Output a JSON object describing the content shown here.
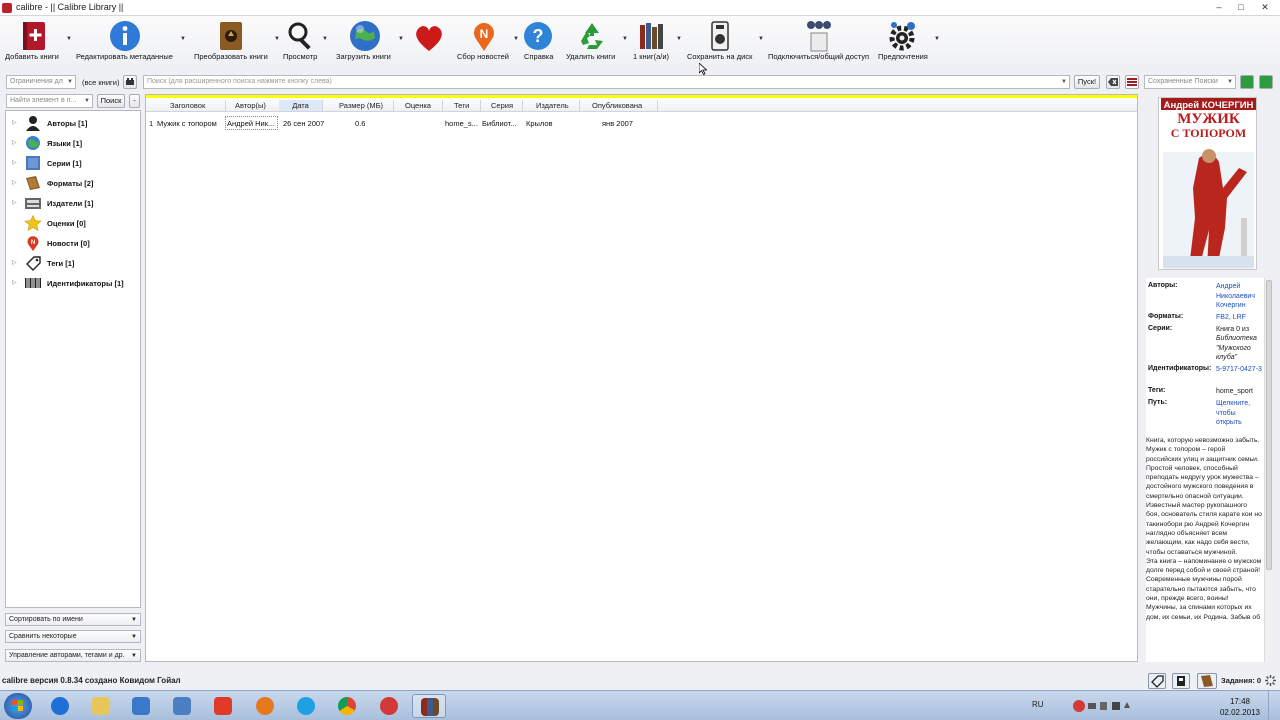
{
  "window": {
    "title": "calibre - || Calibre Library ||",
    "minimize_label": "–",
    "maximize_label": "□",
    "close_label": "✕"
  },
  "toolbar": {
    "items": [
      {
        "label": "Добавить книги",
        "icon": "add-book-icon"
      },
      {
        "label": "Редактировать метаданные",
        "icon": "info-icon"
      },
      {
        "label": "Преобразовать книги",
        "icon": "convert-icon"
      },
      {
        "label": "Просмотр",
        "icon": "magnifier-icon"
      },
      {
        "label": "Загрузить книги",
        "icon": "globe-icon"
      },
      {
        "label": "",
        "icon": "heart-icon"
      },
      {
        "label": "Сбор новостей",
        "icon": "news-icon"
      },
      {
        "label": "Справка",
        "icon": "help-icon"
      },
      {
        "label": "Удалить книги",
        "icon": "recycle-icon"
      },
      {
        "label": "1 книг(а/и)",
        "icon": "library-icon"
      },
      {
        "label": "Сохранить на диск",
        "icon": "save-icon"
      },
      {
        "label": "Подключиться/общий доступ",
        "icon": "connect-icon"
      },
      {
        "label": "Предпочтения",
        "icon": "gear-icon"
      }
    ]
  },
  "search": {
    "restrict_label": "Ограничения дл",
    "all_books": "(все книги)",
    "placeholder": "Поиск (для расширенного поиска нажмите кнопку слева)",
    "go_label": "Пуск!",
    "saved_searches": "Сохраненные Поиски"
  },
  "tagbrowser": {
    "find_placeholder": "Найти элемент в п...",
    "find_button": "Поиск",
    "collapse_button": "-",
    "categories": [
      {
        "label": "Авторы",
        "count": "[1]",
        "icon": "user-icon"
      },
      {
        "label": "Языки",
        "count": "[1]",
        "icon": "languages-icon"
      },
      {
        "label": "Серии",
        "count": "[1]",
        "icon": "series-icon"
      },
      {
        "label": "Форматы",
        "count": "[2]",
        "icon": "book-icon"
      },
      {
        "label": "Издатели",
        "count": "[1]",
        "icon": "publisher-icon"
      },
      {
        "label": "Оценки",
        "count": "[0]",
        "icon": "star-icon"
      },
      {
        "label": "Новости",
        "count": "[0]",
        "icon": "news-icon"
      },
      {
        "label": "Теги",
        "count": "[1]",
        "icon": "tag-icon"
      },
      {
        "label": "Идентификаторы",
        "count": "[1]",
        "icon": "barcode-icon"
      }
    ],
    "sort_by": "Сортировать по имени",
    "match": "Сравнить некоторые",
    "manage": "Управление авторами, тегами и др."
  },
  "booklist": {
    "columns": [
      "Заголовок",
      "Автор(ы)",
      "Дата",
      "Размер (МБ)",
      "Оценка",
      "Теги",
      "Серия",
      "Издатель",
      "Опубликована"
    ],
    "rows": [
      {
        "num": "1",
        "title": "Мужик с топором",
        "author": "Андрей Ник...",
        "date": "26 сен 2007",
        "size": "0.6",
        "rating": "",
        "tags": "home_s...",
        "series": "Библиот...",
        "publisher": "Крылов",
        "published": "янв 2007"
      }
    ]
  },
  "cover": {
    "author": "Андрей КОЧЕРГИН",
    "title_line1": "МУЖИК",
    "title_line2": "С ТОПОРОМ"
  },
  "details": {
    "authors_key": "Авторы:",
    "authors_val": "Андрей Николаевич Кочергин",
    "formats_key": "Форматы:",
    "formats_val": "FB2, LRF",
    "series_key": "Серии:",
    "series_val_1": "Книга 0 из",
    "series_val_2": "Библиотека \"Мужского клуба\"",
    "ids_key": "Идентификаторы:",
    "ids_val": "5-9717-0427-3",
    "tags_key": "Теги:",
    "tags_val": "home_sport",
    "path_key": "Путь:",
    "path_val": "Щелкните, чтобы открыть",
    "comments": "Книга, которую невозможно забыть. Мужик с топором – герой российских улиц и защитник семьи. Простой человек, способный преподать недругу урок мужества – достойного мужского поведения в смертельно опасной ситуации. Известный мастер рукопашного боя, основатель стиля карате кои но такинобори рю Андрей Кочергин наглядно объясняет всем желающим, как надо себя вести, чтобы оставаться мужчиной.\nЭта книга – напоминание о мужском долге перед собой и своей страной! Современные мужчины порой старательно пытаются забыть, что они, прежде всего, воины! Мужчины, за спинами которых их дом, их семьи, их Родина. Забыв об"
  },
  "statusbar": {
    "version": "calibre версия 0.8.34 создано Ковидом Гойал",
    "jobs": "Задания: 0"
  },
  "taskbar": {
    "lang": "RU",
    "time": "17:48",
    "date": "02.02.2013"
  },
  "colors": {
    "accent": "#1a4fbf",
    "highlight": "#ffff00",
    "taskbar": "#b4c8e4"
  }
}
